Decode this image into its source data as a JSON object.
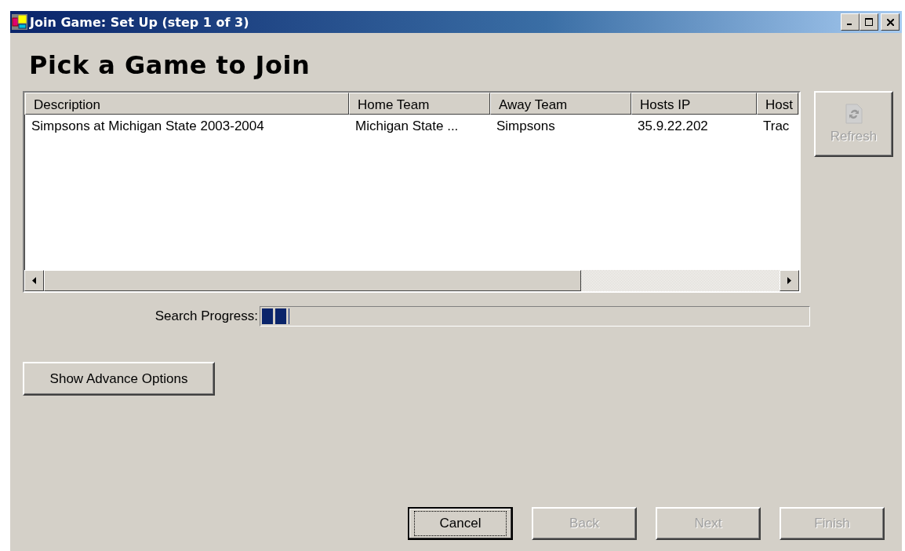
{
  "window": {
    "title": "Join Game: Set Up (step 1 of 3)"
  },
  "heading": "Pick a Game to Join",
  "table": {
    "columns": [
      "Description",
      "Home Team",
      "Away Team",
      "Hosts IP",
      "Host"
    ],
    "rows": [
      {
        "cells": [
          "Simpsons at Michigan State 2003-2004",
          "Michigan State ...",
          "Simpsons",
          "35.9.22.202",
          "Trac"
        ],
        "selected": false
      }
    ]
  },
  "refresh_button": {
    "label": "Refresh",
    "disabled": true
  },
  "search_progress": {
    "label": "Search Progress:",
    "level": 0.05
  },
  "advance_button": {
    "label": "Show Advance Options",
    "disabled": false
  },
  "buttons": [
    {
      "label": "Cancel",
      "disabled": false,
      "focused": true
    },
    {
      "label": "Back",
      "disabled": true,
      "focused": false
    },
    {
      "label": "Next",
      "disabled": true,
      "focused": false
    },
    {
      "label": "Finish",
      "disabled": true,
      "focused": false
    }
  ]
}
